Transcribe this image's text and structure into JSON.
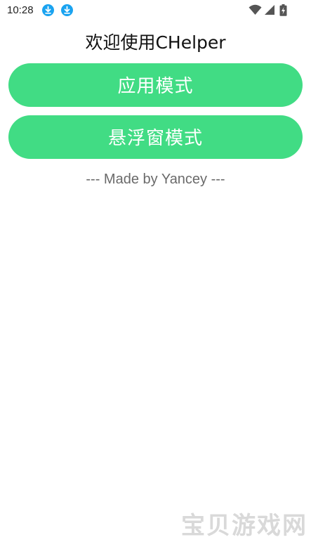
{
  "status_bar": {
    "time": "10:28",
    "notification_icons": [
      "download-icon",
      "download-icon"
    ],
    "notification_color": "#1aa3f0",
    "system_icons": [
      "wifi-icon",
      "signal-icon",
      "battery-charging-icon"
    ]
  },
  "main": {
    "title": "欢迎使用CHelper",
    "app_mode_label": "应用模式",
    "float_mode_label": "悬浮窗模式",
    "credit": "--- Made by Yancey ---"
  },
  "colors": {
    "accent": "#41dc84"
  },
  "watermark": {
    "text": "宝贝游戏网"
  }
}
